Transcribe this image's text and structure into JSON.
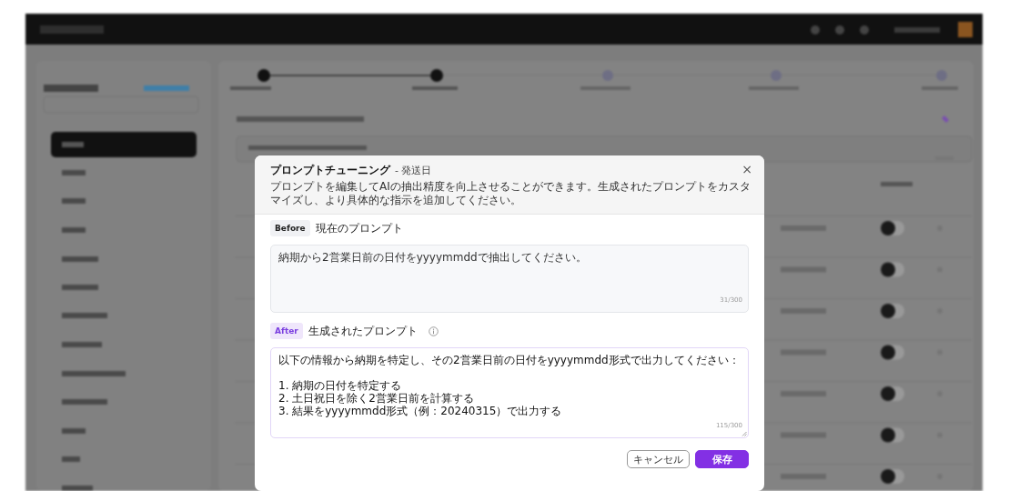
{
  "dialog": {
    "title": "プロンプトチューニング",
    "subtitle": "- 発送日",
    "close": "×",
    "description": "プロンプトを編集してAIの抽出精度を向上させることができます。生成されたプロンプトをカスタマイズし、より具体的な指示を追加してください。",
    "sections": [
      {
        "kind": "before",
        "tag": "Before",
        "label": "現在のプロンプト",
        "value": "納期から2営業日前の日付をyyyymmddで抽出してください。",
        "counter": "31/300"
      },
      {
        "kind": "after",
        "tag": "After",
        "label": "生成されたプロンプト",
        "value": "以下の情報から納期を特定し、その2営業日前の日付をyyyymmdd形式で出力してください：\n\n1. 納期の日付を特定する\n2. 土日祝日を除く2営業日前を計算する\n3. 結果をyyyymmdd形式（例：20240315）で出力する",
        "counter": "115/300"
      }
    ],
    "buttons": [
      {
        "label": "キャンセル",
        "kind": "secondary"
      },
      {
        "label": "保存",
        "kind": "primary"
      }
    ]
  }
}
